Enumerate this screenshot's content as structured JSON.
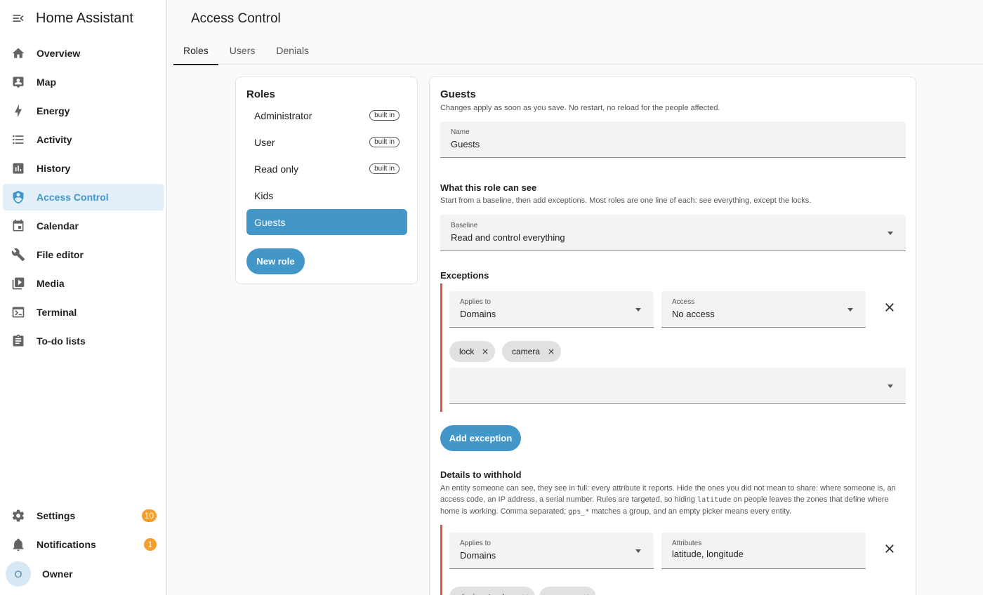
{
  "app": {
    "title": "Home Assistant"
  },
  "sidebar": {
    "items": [
      {
        "label": "Overview",
        "icon": "home-icon"
      },
      {
        "label": "Map",
        "icon": "map-icon"
      },
      {
        "label": "Energy",
        "icon": "lightning-icon"
      },
      {
        "label": "Activity",
        "icon": "list-icon"
      },
      {
        "label": "History",
        "icon": "chart-bar-icon"
      },
      {
        "label": "Access Control",
        "icon": "shield-account-icon",
        "active": true
      },
      {
        "label": "Calendar",
        "icon": "calendar-icon"
      },
      {
        "label": "File editor",
        "icon": "wrench-icon"
      },
      {
        "label": "Media",
        "icon": "play-box-icon"
      },
      {
        "label": "Terminal",
        "icon": "console-icon"
      },
      {
        "label": "To-do lists",
        "icon": "clipboard-list-icon"
      }
    ],
    "settings": {
      "label": "Settings",
      "badge": "10"
    },
    "notifications": {
      "label": "Notifications",
      "badge": "1"
    },
    "user": {
      "initial": "O",
      "name": "Owner"
    }
  },
  "page": {
    "title": "Access Control",
    "tabs": [
      "Roles",
      "Users",
      "Denials"
    ]
  },
  "roles": {
    "title": "Roles",
    "builtin_label": "built in",
    "items": [
      {
        "name": "Administrator",
        "builtin": true
      },
      {
        "name": "User",
        "builtin": true
      },
      {
        "name": "Read only",
        "builtin": true
      },
      {
        "name": "Kids",
        "builtin": false
      },
      {
        "name": "Guests",
        "builtin": false,
        "selected": true
      }
    ],
    "new_role_label": "New role"
  },
  "detail": {
    "title": "Guests",
    "subtitle": "Changes apply as soon as you save. No restart, no reload for the people affected.",
    "name_field": {
      "label": "Name",
      "value": "Guests"
    },
    "visibility": {
      "title": "What this role can see",
      "description": "Start from a baseline, then add exceptions. Most roles are one line of each: see everything, except the locks.",
      "baseline": {
        "label": "Baseline",
        "value": "Read and control everything"
      }
    },
    "exceptions": {
      "title": "Exceptions",
      "applies_to": {
        "label": "Applies to",
        "value": "Domains"
      },
      "access": {
        "label": "Access",
        "value": "No access"
      },
      "chips": [
        "lock",
        "camera"
      ],
      "add_label": "Add exception"
    },
    "withhold": {
      "title": "Details to withhold",
      "desc_1": "An entity someone can see, they see in full: every attribute it reports. Hide the ones you did not mean to share: where someone is, an access code, an IP address, a serial number. Rules are targeted, so hiding ",
      "desc_code_1": "latitude",
      "desc_2": " on people leaves the zones that define where home is working. Comma separated; ",
      "desc_code_2": "gps_*",
      "desc_3": " matches a group, and an empty picker means every entity.",
      "applies_to": {
        "label": "Applies to",
        "value": "Domains"
      },
      "attributes": {
        "label": "Attributes",
        "value": "latitude, longitude"
      },
      "chips": [
        "device_tracker",
        "person"
      ]
    }
  }
}
